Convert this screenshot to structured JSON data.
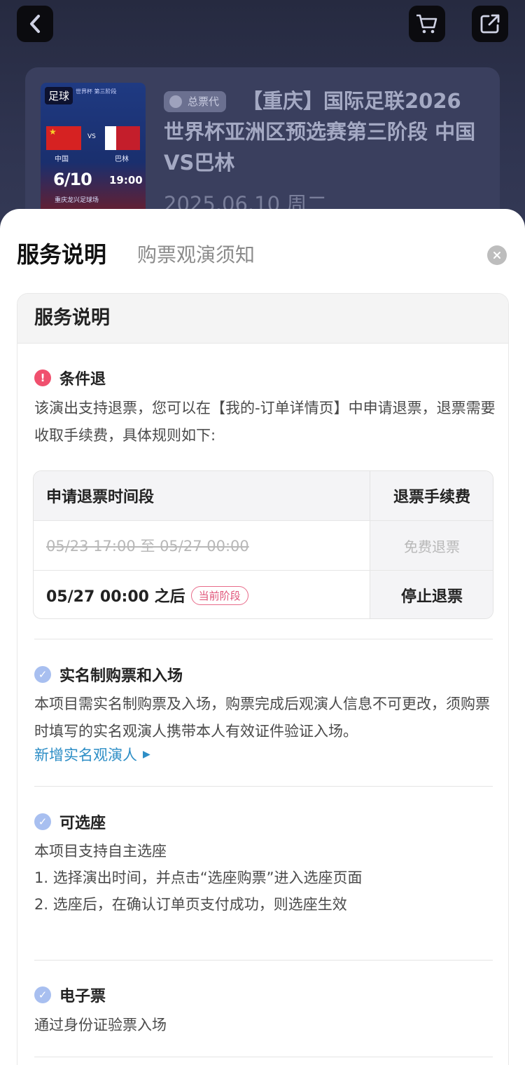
{
  "header": {
    "back_icon": "chevron-left-icon",
    "cart_icon": "cart-icon",
    "share_icon": "share-icon"
  },
  "event": {
    "poster": {
      "tag": "足球",
      "subtitle": "世界杯 第三阶段",
      "team_home": "中国",
      "vs": "VS",
      "team_away": "巴林",
      "date": "6/10",
      "time": "19:00",
      "venue": "重庆龙兴足球场"
    },
    "agent_badge": "总票代",
    "title": "【重庆】国际足联2026世界杯亚洲区预选赛第三阶段 中国VS巴林",
    "date": "2025.06.10 周二"
  },
  "sheet": {
    "tabs": [
      "服务说明",
      "购票观演须知"
    ],
    "active_tab": 0,
    "close_icon": "close-icon",
    "panel_title": "服务说明",
    "refund": {
      "title": "条件退",
      "text": "该演出支持退票，您可以在【我的-订单详情页】中申请退票，退票需要收取手续费，具体规则如下:",
      "table": {
        "header": [
          "申请退票时间段",
          "退票手续费"
        ],
        "rows": [
          {
            "period": "05/23 17:00 至 05/27 00:00",
            "fee": "免费退票",
            "expired": true
          },
          {
            "period": "05/27 00:00 之后",
            "badge": "当前阶段",
            "fee": "停止退票",
            "expired": false
          }
        ]
      }
    },
    "realname": {
      "title": "实名制购票和入场",
      "text": "本项目需实名制购票及入场，购票完成后观演人信息不可更改，须购票时填写的实名观演人携带本人有效证件验证入场。",
      "link": "新增实名观演人"
    },
    "seat": {
      "title": "可选座",
      "lines": [
        "本项目支持自主选座",
        "1. 选择演出时间，并点击“选座购票”进入选座页面",
        "2. 选座后，在确认订单页支付成功，则选座生效"
      ]
    },
    "eticket": {
      "title": "电子票",
      "text": "通过身份证验票入场"
    }
  }
}
